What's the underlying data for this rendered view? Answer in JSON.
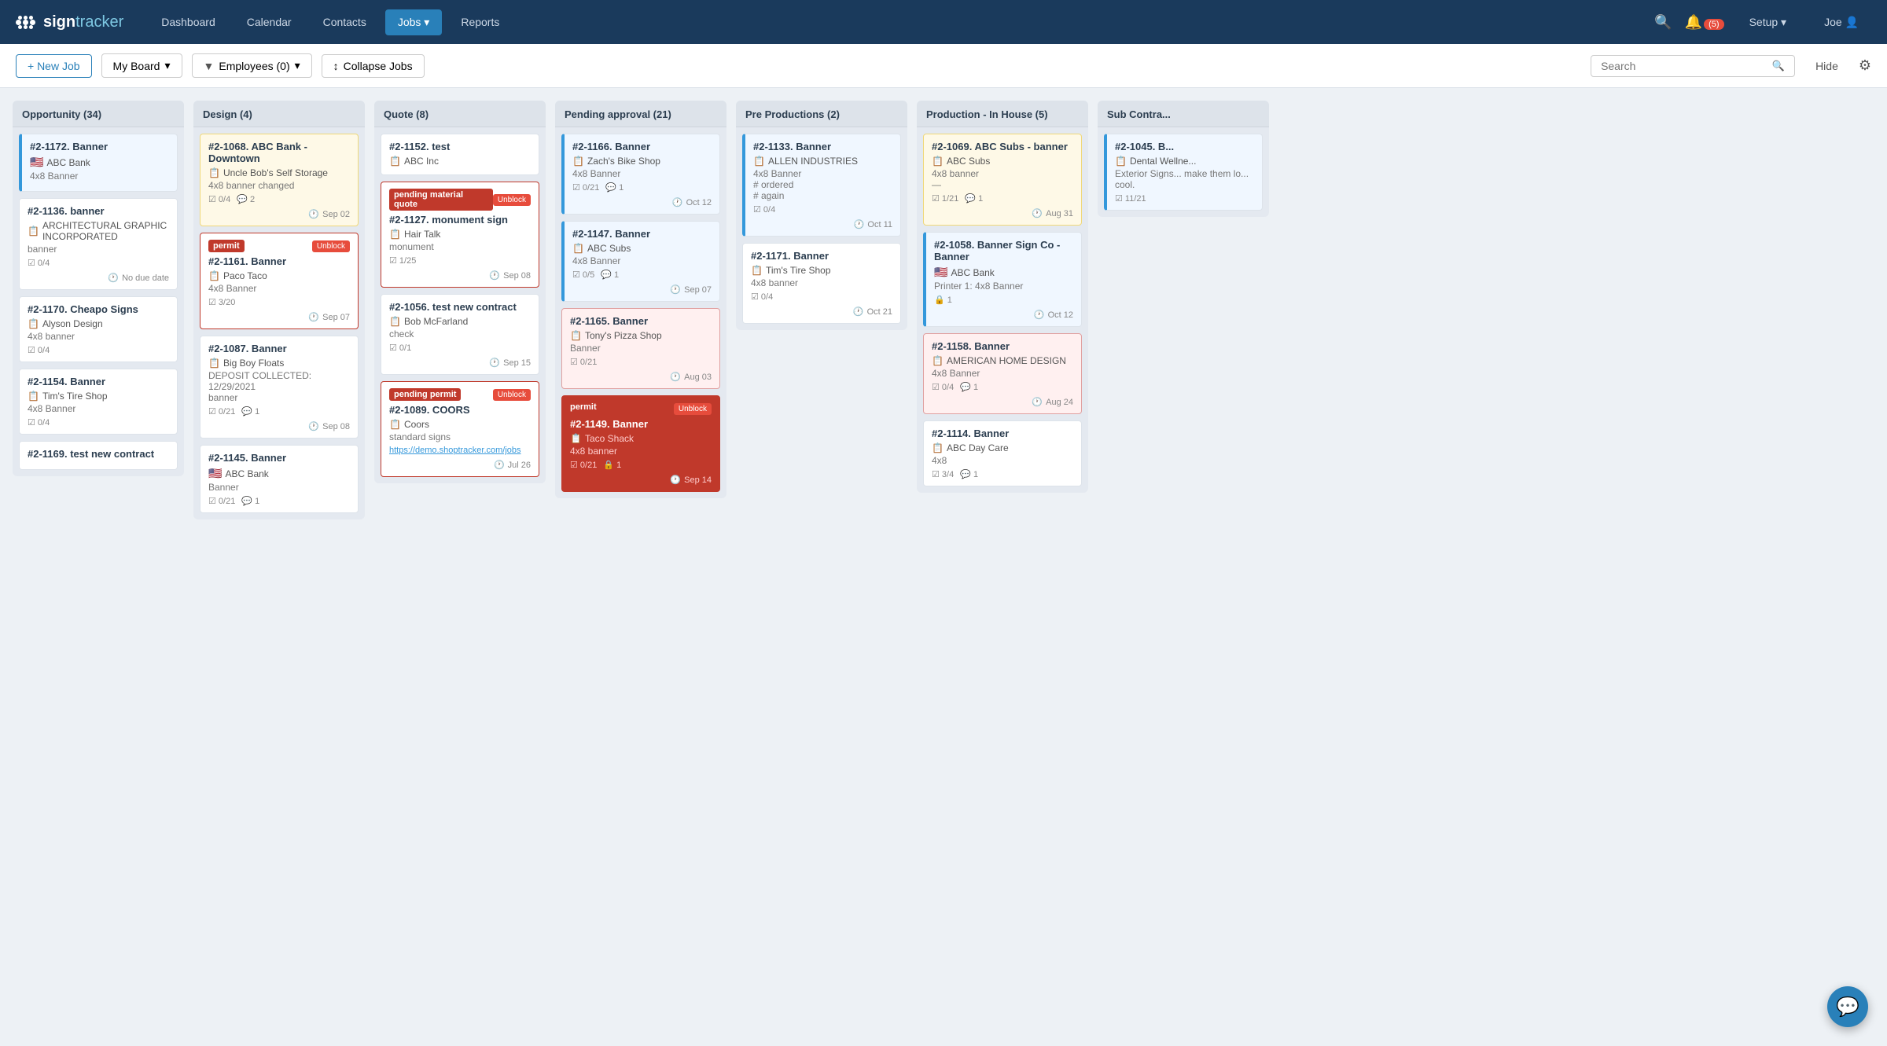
{
  "navbar": {
    "brand": "signtracker",
    "links": [
      {
        "label": "Dashboard",
        "active": false
      },
      {
        "label": "Calendar",
        "active": false
      },
      {
        "label": "Contacts",
        "active": false
      },
      {
        "label": "Jobs",
        "active": true,
        "arrow": true
      },
      {
        "label": "Reports",
        "active": false
      }
    ],
    "bell_count": "(5)",
    "setup_label": "Setup",
    "user_label": "Joe"
  },
  "toolbar": {
    "new_job": "+ New Job",
    "my_board": "My Board",
    "employees": "Employees (0)",
    "collapse": "Collapse Jobs",
    "search_placeholder": "Search",
    "hide": "Hide"
  },
  "columns": [
    {
      "id": "opportunity",
      "title": "Opportunity (34)",
      "cards": [
        {
          "id": "#2-1172. Banner",
          "company": "ABC Bank",
          "type": "4x8 Banner",
          "meta": [],
          "date": null,
          "style": "blue-border",
          "flag": true
        },
        {
          "id": "#2-1136. banner",
          "company": "ARCHITECTURAL GRAPHIC INCORPORATED",
          "type": "banner",
          "meta": [
            {
              "icon": "checklist",
              "text": "0/4"
            }
          ],
          "date": "No due date",
          "style": "normal"
        },
        {
          "id": "#2-1170. Cheapo Signs",
          "company": "Alyson Design",
          "type": "4x8 banner",
          "meta": [
            {
              "icon": "checklist",
              "text": "0/4"
            }
          ],
          "date": null,
          "style": "normal"
        },
        {
          "id": "#2-1154. Banner",
          "company": "Tim's Tire Shop",
          "type": "4x8 Banner",
          "meta": [
            {
              "icon": "checklist",
              "text": "0/4"
            }
          ],
          "date": null,
          "style": "normal"
        },
        {
          "id": "#2-1169. test new contract",
          "company": "",
          "type": "",
          "meta": [],
          "date": null,
          "style": "normal"
        }
      ]
    },
    {
      "id": "design",
      "title": "Design (4)",
      "cards": [
        {
          "id": "#2-1068. ABC Bank - Downtown",
          "company": "Uncle Bob's Self Storage",
          "type": "4x8 banner changed",
          "meta": [
            {
              "icon": "checklist",
              "text": "0/4"
            },
            {
              "icon": "comment",
              "text": "2"
            }
          ],
          "date": "Sep 02",
          "style": "yellow-bg"
        },
        {
          "id": "#2-1161. Banner",
          "company": "Paco Taco",
          "type": "4x8 Banner",
          "meta": [
            {
              "icon": "checklist",
              "text": "3/20"
            }
          ],
          "date": "Sep 07",
          "style": "red-header",
          "status_label": "permit",
          "unblock": true
        },
        {
          "id": "#2-1087. Banner",
          "company": "Big Boy Floats",
          "type": "DEPOSIT COLLECTED: 12/29/2021\nbanner",
          "meta": [
            {
              "icon": "checklist",
              "text": "0/21"
            },
            {
              "icon": "comment",
              "text": "1"
            }
          ],
          "date": "Sep 08",
          "style": "normal"
        },
        {
          "id": "#2-1145. Banner",
          "company": "ABC Bank",
          "type": "Banner",
          "meta": [
            {
              "icon": "checklist",
              "text": "0/21"
            },
            {
              "icon": "comment",
              "text": "1"
            }
          ],
          "date": null,
          "style": "normal",
          "flag": true
        }
      ]
    },
    {
      "id": "quote",
      "title": "Quote (8)",
      "cards": [
        {
          "id": "#2-1152. test",
          "company": "ABC Inc",
          "type": "",
          "meta": [],
          "date": null,
          "style": "normal"
        },
        {
          "id": "#2-1127. monument sign",
          "company": "Hair Talk",
          "type": "monument",
          "meta": [
            {
              "icon": "checklist",
              "text": "1/25"
            }
          ],
          "date": "Sep 08",
          "style": "red-header",
          "status_label": "pending material quote",
          "unblock": true
        },
        {
          "id": "#2-1056. test new contract",
          "company": "Bob McFarland",
          "type": "check",
          "meta": [
            {
              "icon": "checklist",
              "text": "0/1"
            }
          ],
          "date": "Sep 15",
          "style": "normal"
        },
        {
          "id": "#2-1089. COORS",
          "company": "Coors",
          "type": "standard signs",
          "meta": [],
          "link": "https://demo.shoptracker.com/jobs",
          "date": "Jul 26",
          "style": "red-header",
          "status_label": "pending permit",
          "unblock": true
        }
      ]
    },
    {
      "id": "pending_approval",
      "title": "Pending approval (21)",
      "cards": [
        {
          "id": "#2-1166. Banner",
          "company": "Zach's Bike Shop",
          "type": "4x8 Banner",
          "meta": [
            {
              "icon": "checklist",
              "text": "0/21"
            },
            {
              "icon": "comment",
              "text": "1"
            }
          ],
          "date": "Oct 12",
          "style": "blue-border"
        },
        {
          "id": "#2-1147. Banner",
          "company": "ABC Subs",
          "type": "4x8 Banner",
          "meta": [
            {
              "icon": "checklist",
              "text": "0/5"
            },
            {
              "icon": "comment",
              "text": "1"
            }
          ],
          "date": "Sep 07",
          "style": "blue-border"
        },
        {
          "id": "#2-1165. Banner",
          "company": "Tony's Pizza Shop",
          "type": "Banner",
          "meta": [
            {
              "icon": "checklist",
              "text": "0/21"
            }
          ],
          "date": "Aug 03",
          "style": "pink-bg"
        },
        {
          "id": "#2-1149. Banner",
          "company": "Taco Shack",
          "type": "4x8 banner",
          "meta": [
            {
              "icon": "checklist",
              "text": "0/21"
            },
            {
              "icon": "lock",
              "text": "1"
            }
          ],
          "date": "Sep 14",
          "style": "dark-red",
          "status_label": "permit",
          "unblock": true
        }
      ]
    },
    {
      "id": "pre_productions",
      "title": "Pre Productions (2)",
      "cards": [
        {
          "id": "#2-1133. Banner",
          "company": "ALLEN INDUSTRIES",
          "type": "4x8 Banner\n# ordered\n# again",
          "meta": [
            {
              "icon": "checklist",
              "text": "0/4"
            }
          ],
          "date": "Oct 11",
          "style": "blue-border"
        },
        {
          "id": "#2-1171. Banner",
          "company": "Tim's Tire Shop",
          "type": "4x8 banner",
          "meta": [
            {
              "icon": "checklist",
              "text": "0/4"
            }
          ],
          "date": "Oct 21",
          "style": "normal"
        }
      ]
    },
    {
      "id": "production_in_house",
      "title": "Production - In House (5)",
      "cards": [
        {
          "id": "#2-1069. ABC Subs - banner",
          "company": "ABC Subs",
          "type": "4x8 banner\n—",
          "meta": [
            {
              "icon": "checklist",
              "text": "1/21"
            },
            {
              "icon": "comment",
              "text": "1"
            }
          ],
          "date": "Aug 31",
          "style": "yellow-bg"
        },
        {
          "id": "#2-1058. Banner Sign Co - Banner",
          "company": "ABC Bank",
          "type": "Printer 1: 4x8 Banner",
          "meta": [
            {
              "icon": "lock",
              "text": "1"
            }
          ],
          "date": "Oct 12",
          "style": "blue-border",
          "flag": true
        },
        {
          "id": "#2-1158. Banner",
          "company": "AMERICAN HOME DESIGN",
          "type": "4x8 Banner",
          "meta": [
            {
              "icon": "checklist",
              "text": "0/4"
            },
            {
              "icon": "comment",
              "text": "1"
            }
          ],
          "date": "Aug 24",
          "style": "pink-bg"
        },
        {
          "id": "#2-1114. Banner",
          "company": "ABC Day Care",
          "type": "4x8",
          "meta": [
            {
              "icon": "checklist",
              "text": "3/4"
            },
            {
              "icon": "comment",
              "text": "1"
            }
          ],
          "date": null,
          "style": "normal"
        }
      ]
    },
    {
      "id": "sub_contra",
      "title": "Sub Contra...",
      "cards": [
        {
          "id": "#2-1045. B...",
          "company": "Dental Wellne...",
          "type": "Exterior Signs... make them lo... cool.",
          "meta": [
            {
              "icon": "checklist",
              "text": "11/21"
            }
          ],
          "date": null,
          "style": "blue-border"
        }
      ]
    }
  ]
}
